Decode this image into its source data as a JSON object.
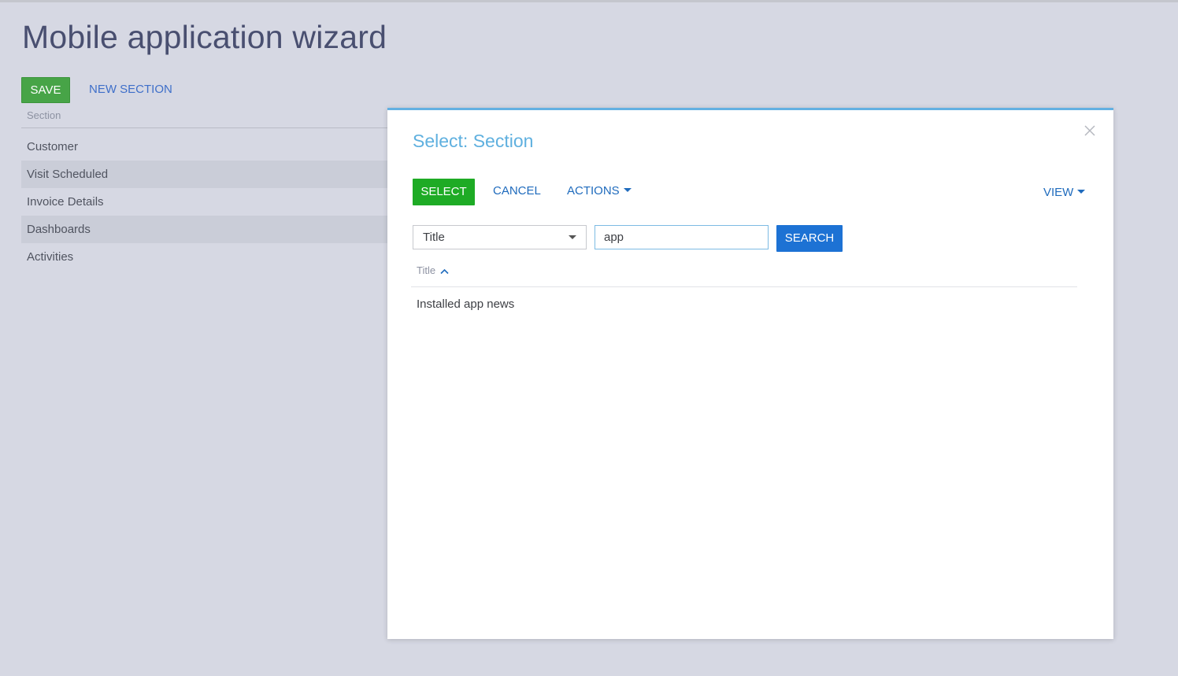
{
  "page": {
    "title": "Mobile application wizard",
    "save_label": "SAVE",
    "new_section_label": "NEW SECTION",
    "section_column_header": "Section",
    "sections": [
      {
        "label": "Customer"
      },
      {
        "label": "Visit Scheduled"
      },
      {
        "label": "Invoice Details"
      },
      {
        "label": "Dashboards"
      },
      {
        "label": "Activities"
      }
    ]
  },
  "modal": {
    "title": "Select: Section",
    "close_icon": "close-icon",
    "select_label": "SELECT",
    "cancel_label": "CANCEL",
    "actions_label": "ACTIONS",
    "view_label": "VIEW",
    "filter_field_value": "Title",
    "search_value": "app",
    "search_label": "SEARCH",
    "column_header": "Title",
    "sort_direction": "ascending",
    "results": [
      {
        "title": "Installed app news"
      }
    ]
  },
  "colors": {
    "save_green": "#47a447",
    "select_green": "#1eab25",
    "search_blue": "#1d72d4",
    "link_blue": "#1f6bbd",
    "modal_title_blue": "#5fb0df",
    "background": "#d6d8e3"
  }
}
